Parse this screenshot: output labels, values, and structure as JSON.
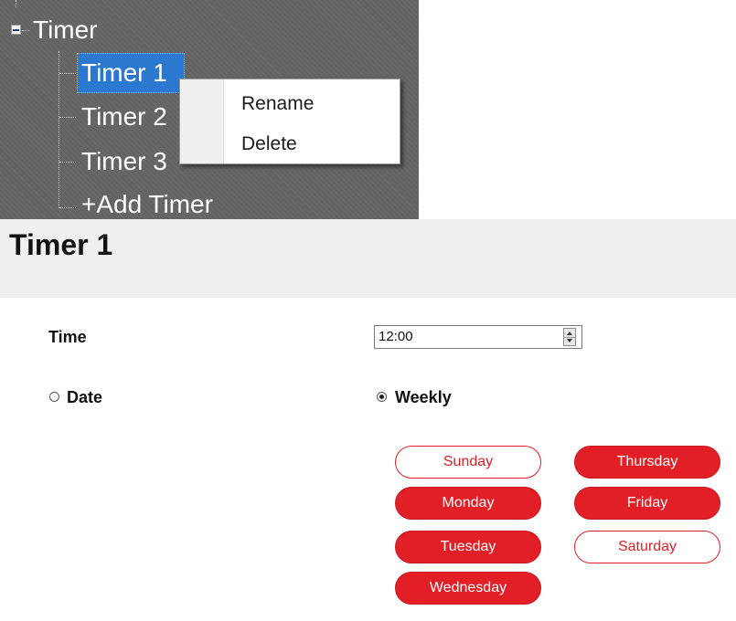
{
  "tree": {
    "root_label": "Timer",
    "items": [
      {
        "label": "Timer 1",
        "selected": true
      },
      {
        "label": "Timer 2",
        "selected": false
      },
      {
        "label": "Timer 3",
        "selected": false
      }
    ],
    "add_label": "+Add Timer"
  },
  "context_menu": {
    "items": [
      "Rename",
      "Delete"
    ]
  },
  "detail": {
    "title": "Timer 1",
    "time_label": "Time",
    "time_value": "12:00",
    "date_option": "Date",
    "weekly_option": "Weekly",
    "selected_mode": "Weekly",
    "days": [
      {
        "label": "Sunday",
        "active": false
      },
      {
        "label": "Monday",
        "active": true
      },
      {
        "label": "Tuesday",
        "active": true
      },
      {
        "label": "Wednesday",
        "active": true
      },
      {
        "label": "Thursday",
        "active": true
      },
      {
        "label": "Friday",
        "active": true
      },
      {
        "label": "Saturday",
        "active": false
      }
    ]
  },
  "colors": {
    "tree_bg": "#636363",
    "selection": "#2b78d0",
    "accent_red": "#e21f26"
  }
}
